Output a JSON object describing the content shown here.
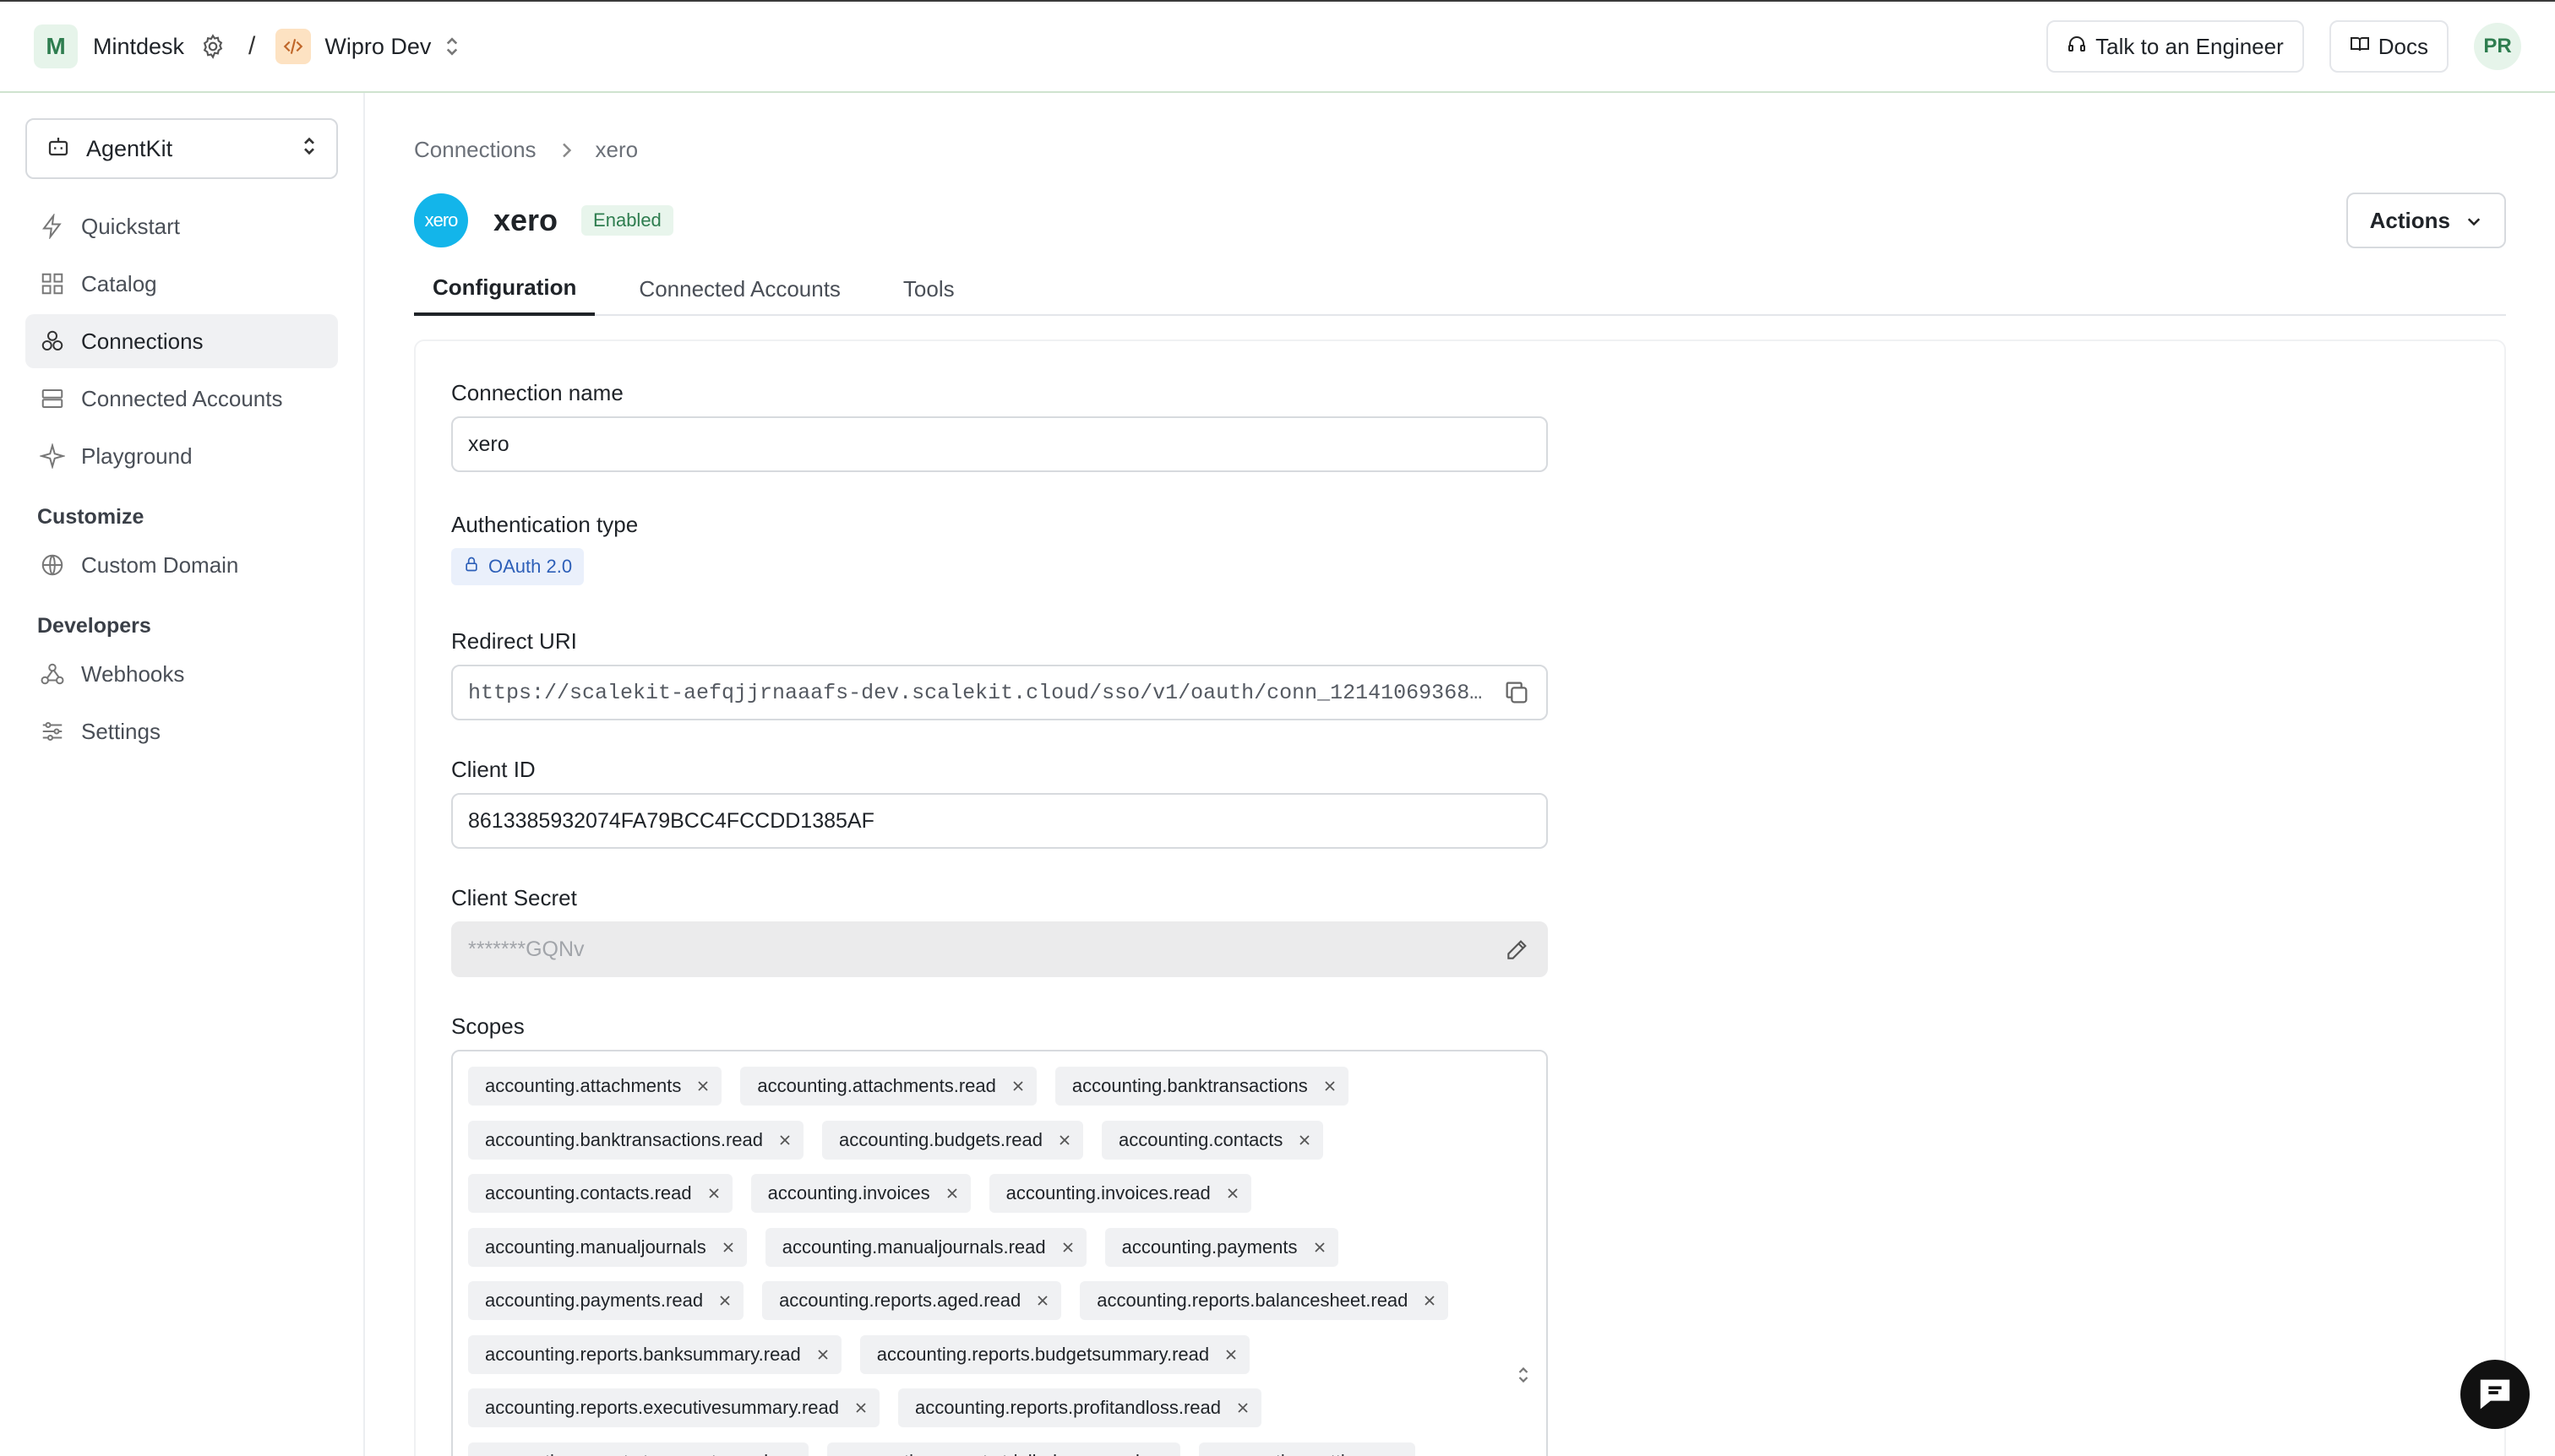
{
  "topbar": {
    "workspace_initial": "M",
    "workspace_name": "Mintdesk",
    "separator": "/",
    "environment_name": "Wipro Dev",
    "talk_label": "Talk to an Engineer",
    "docs_label": "Docs",
    "avatar_initials": "PR"
  },
  "sidebar": {
    "product": "AgentKit",
    "items": [
      {
        "label": "Quickstart",
        "icon": "bolt-icon"
      },
      {
        "label": "Catalog",
        "icon": "grid-icon"
      },
      {
        "label": "Connections",
        "icon": "connections-icon",
        "active": true
      },
      {
        "label": "Connected Accounts",
        "icon": "server-icon"
      },
      {
        "label": "Playground",
        "icon": "sparkle-icon"
      }
    ],
    "customize_heading": "Customize",
    "customize_items": [
      {
        "label": "Custom Domain",
        "icon": "globe-icon"
      }
    ],
    "developers_heading": "Developers",
    "developer_items": [
      {
        "label": "Webhooks",
        "icon": "webhook-icon"
      },
      {
        "label": "Settings",
        "icon": "sliders-icon"
      }
    ]
  },
  "breadcrumb": {
    "root": "Connections",
    "current": "xero"
  },
  "connection": {
    "logo_text": "xero",
    "title": "xero",
    "status": "Enabled",
    "actions_label": "Actions"
  },
  "tabs": [
    {
      "label": "Configuration",
      "active": true
    },
    {
      "label": "Connected Accounts"
    },
    {
      "label": "Tools"
    }
  ],
  "form": {
    "connection_name_label": "Connection name",
    "connection_name_value": "xero",
    "auth_type_label": "Authentication type",
    "auth_type_value": "OAuth 2.0",
    "redirect_uri_label": "Redirect URI",
    "redirect_uri_value": "https://scalekit-aefqjjrnaaafs-dev.scalekit.cloud/sso/v1/oauth/conn_12141069368…",
    "client_id_label": "Client ID",
    "client_id_value": "8613385932074FA79BCC4FCCDD1385AF",
    "client_secret_label": "Client Secret",
    "client_secret_value": "*******GQNv",
    "scopes_label": "Scopes",
    "scopes": [
      "accounting.attachments",
      "accounting.attachments.read",
      "accounting.banktransactions",
      "accounting.banktransactions.read",
      "accounting.budgets.read",
      "accounting.contacts",
      "accounting.contacts.read",
      "accounting.invoices",
      "accounting.invoices.read",
      "accounting.manualjournals",
      "accounting.manualjournals.read",
      "accounting.payments",
      "accounting.payments.read",
      "accounting.reports.aged.read",
      "accounting.reports.balancesheet.read",
      "accounting.reports.banksummary.read",
      "accounting.reports.budgetsummary.read",
      "accounting.reports.executivesummary.read",
      "accounting.reports.profitandloss.read",
      "accounting.reports.taxreports.read",
      "accounting.reports.trialbalance.read",
      "accounting.settings"
    ]
  },
  "colors": {
    "accent_green": "#2e7d4f",
    "xero_blue": "#13b5ea",
    "auth_blue": "#2d5fb8"
  }
}
